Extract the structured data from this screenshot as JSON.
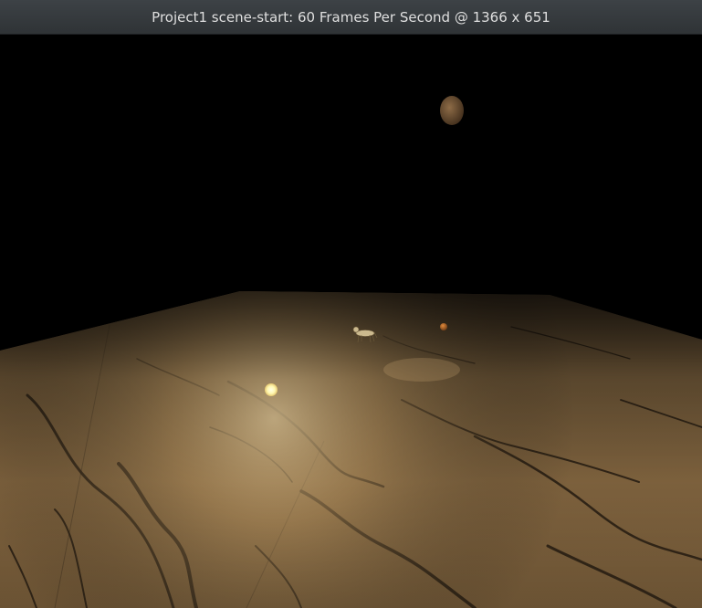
{
  "window": {
    "title": "Project1 scene-start: 60 Frames Per Second @ 1366 x 651"
  },
  "scene": {
    "background_color": "#000000",
    "floor_texture": "marble",
    "floor_color": "#a38355",
    "floor_vein_color": "#1a130c",
    "light_color": "#fffbc4",
    "sphere_color": "#7a5a3a",
    "small_sphere_color": "#b86a28",
    "objects": [
      "floor",
      "moon-sphere",
      "light-sphere",
      "small-sphere",
      "dog-model",
      "floor-shadow"
    ]
  }
}
